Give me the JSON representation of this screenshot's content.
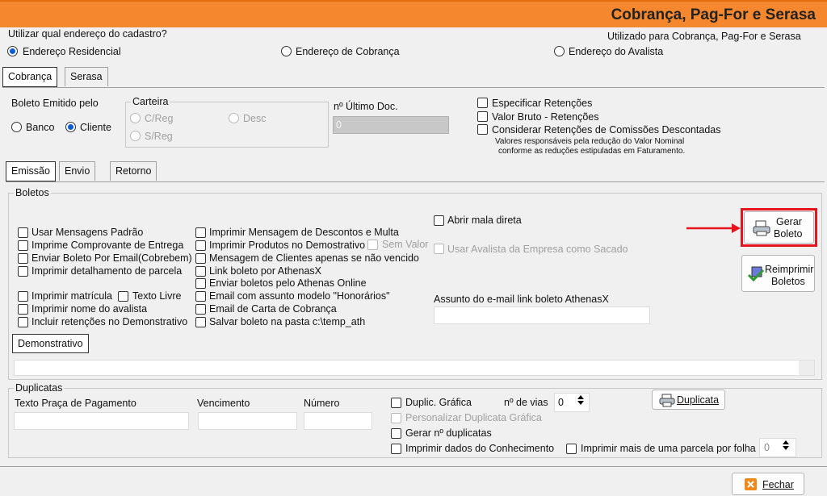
{
  "window": {
    "title": "Cobrança, Pag-For e Serasa"
  },
  "address": {
    "question": "Utilizar qual endereço do cadastro?",
    "note": "Utilizado para Cobrança, Pag-For e Serasa",
    "options": [
      "Endereço Residencial",
      "Endereço de Cobrança",
      "Endereço do Avalista"
    ],
    "selected": "Endereço Residencial"
  },
  "main_tabs": [
    "Cobrança",
    "Serasa"
  ],
  "boleto_emitido": {
    "label": "Boleto Emitido pelo",
    "options": [
      "Banco",
      "Cliente"
    ],
    "selected": "Cliente"
  },
  "carteira": {
    "label": "Carteira",
    "options": [
      "C/Reg",
      "S/Reg",
      "Desc"
    ]
  },
  "ultimo_doc": {
    "label": "nº Último Doc.",
    "value": "0"
  },
  "retencoes": {
    "items": [
      "Especificar Retenções",
      "Valor Bruto - Retenções",
      "Considerar Retenções de Comissões Descontadas"
    ],
    "note1": "Valores responsáveis pela redução do Valor Nominal",
    "note2": "conforme as reduções estipuladas em Faturamento."
  },
  "sub_tabs": [
    "Emissão",
    "Envio",
    "Retorno"
  ],
  "boletos": {
    "label": "Boletos",
    "col1": [
      "Usar Mensagens Padrão",
      "Imprime Comprovante de Entrega",
      "Enviar Boleto Por Email(Cobrebem)",
      "Imprimir detalhamento de parcela",
      "Imprimir matrícula",
      "Imprimir nome do avalista",
      "Incluir retenções no Demonstrativo"
    ],
    "texto_livre": "Texto Livre",
    "col2": [
      "Imprimir Mensagem de Descontos e Multa",
      "Imprimir Produtos no Demostrativo",
      "Mensagem de Clientes apenas se não vencido",
      "Link boleto por AthenasX",
      "Enviar boletos pelo Athenas Online",
      "Email com assunto modelo \"Honorários\"",
      "Email de Carta de Cobrança",
      "Salvar boleto na pasta c:\\temp_ath"
    ],
    "sem_valor": "Sem Valor",
    "abrir_mala": "Abrir mala direta",
    "usar_avalista": "Usar Avalista da Empresa como Sacado",
    "assunto_label": "Assunto do e-mail link boleto AthenasX",
    "gerar_line1": "Gerar",
    "gerar_line2": "Boleto",
    "reimprimir_line1": "Reimprimir",
    "reimprimir_line2": "Boletos",
    "demonstrativo_tab": "Demonstrativo"
  },
  "duplicatas": {
    "label": "Duplicatas",
    "texto_praca": "Texto Praça de Pagamento",
    "vencimento": "Vencimento",
    "numero": "Número",
    "duplic_grafica": "Duplic. Gráfica",
    "n_vias_label": "nº de vias",
    "n_vias_value": "0",
    "personalizar": "Personalizar Duplicata Gráfica",
    "gerar_n": "Gerar nº duplicatas",
    "imprimir_conhecimento": "Imprimir dados do Conhecimento",
    "imprimir_mais": "Imprimir mais de uma parcela por folha",
    "mais_value": "0",
    "duplicata_btn": "Duplicata"
  },
  "fechar": "Fechar",
  "colors": {
    "title_bar": "#f5872f",
    "highlight": "#e8141c",
    "radio_dot": "#0a5bd8",
    "fechar_icon": "#f08a1c"
  }
}
